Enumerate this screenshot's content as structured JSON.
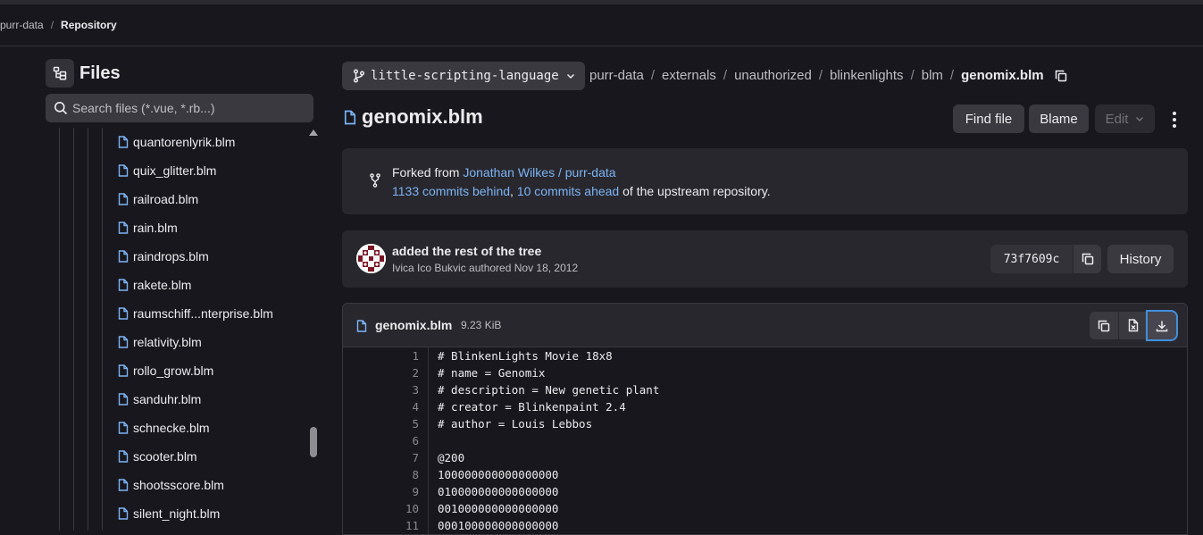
{
  "top_breadcrumb": {
    "project": "purr-data",
    "current": "Repository"
  },
  "sidebar": {
    "title": "Files",
    "search_placeholder": "Search files (*.vue, *.rb...)",
    "files": [
      "quantorenlyrik.blm",
      "quix_glitter.blm",
      "railroad.blm",
      "rain.blm",
      "raindrops.blm",
      "rakete.blm",
      "raumschiff...nterprise.blm",
      "relativity.blm",
      "rollo_grow.blm",
      "sanduhr.blm",
      "schnecke.blm",
      "scooter.blm",
      "shootsscore.blm",
      "silent_night.blm"
    ]
  },
  "branch": "little-scripting-language",
  "path": [
    "purr-data",
    "externals",
    "unauthorized",
    "blinkenlights",
    "blm"
  ],
  "file_name": "genomix.blm",
  "actions": {
    "find_file": "Find file",
    "blame": "Blame",
    "edit": "Edit"
  },
  "fork": {
    "prefix": "Forked from",
    "source": "Jonathan Wilkes / purr-data",
    "behind": "1133 commits behind",
    "comma": ",",
    "ahead": "10 commits ahead",
    "suffix": "of the upstream repository."
  },
  "commit": {
    "title": "added the rest of the tree",
    "meta": "Ivica Ico Bukvic authored Nov 18, 2012",
    "sha": "73f7609c",
    "history": "History"
  },
  "blob": {
    "name": "genomix.blm",
    "size": "9.23 KiB",
    "line_numbers": [
      "1",
      "2",
      "3",
      "4",
      "5",
      "6",
      "7",
      "8",
      "9",
      "10",
      "11"
    ],
    "lines": [
      "# BlinkenLights Movie 18x8",
      "# name = Genomix",
      "# description = New genetic plant",
      "# creator = Blinkenpaint 2.4",
      "# author = Louis Lebbos",
      "",
      "@200",
      "100000000000000000",
      "010000000000000000",
      "001000000000000000",
      "000100000000000000"
    ]
  },
  "colors": {
    "link": "#7cb4f5",
    "background": "#18171d",
    "panel": "#28272d",
    "button": "#3a393f",
    "focus": "#428fdc"
  }
}
